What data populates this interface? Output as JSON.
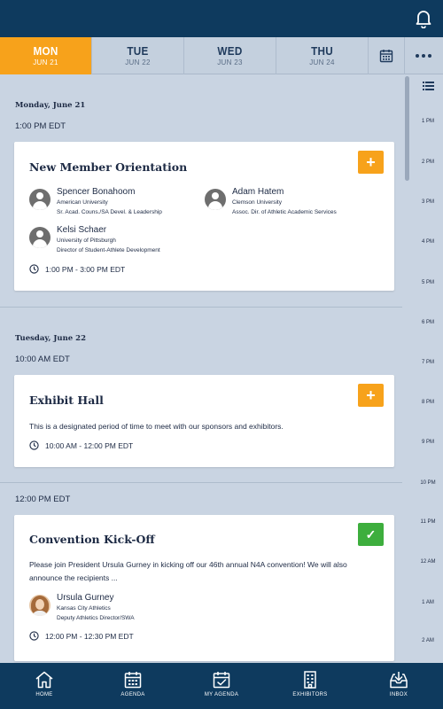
{
  "days": [
    {
      "day": "MON",
      "date": "JUN 21",
      "active": true
    },
    {
      "day": "TUE",
      "date": "JUN 22",
      "active": false
    },
    {
      "day": "WED",
      "date": "JUN 23",
      "active": false
    },
    {
      "day": "THU",
      "date": "JUN 24",
      "active": false
    }
  ],
  "icons": {
    "bell": "bell-icon",
    "calendar": "calendar-icon",
    "more": "more-icon",
    "list": "list-icon",
    "add": "plus-icon",
    "added": "checkmark-icon",
    "clock": "clock-icon"
  },
  "colors": {
    "topbar": "#0e3a5e",
    "accent": "#f7a21b",
    "added": "#3dae3d"
  },
  "sections": {
    "mon": {
      "day_label": "Monday, June 21",
      "time_label": "1:00 PM EDT"
    },
    "tue": {
      "day_label": "Tuesday, June 22",
      "time_label": "10:00 AM EDT"
    },
    "tue2": {
      "time_label": "12:00 PM EDT"
    }
  },
  "events": {
    "orientation": {
      "title": "New Member Orientation",
      "add_label": "+",
      "time": "1:00 PM - 3:00 PM EDT",
      "speakers": [
        {
          "name": "Spencer Bonahoom",
          "org": "American University",
          "role": "Sr. Acad. Couns./SA Devel. & Leadership"
        },
        {
          "name": "Adam Hatem",
          "org": "Clemson University",
          "role": "Assoc. Dir. of Athletic Academic Services"
        },
        {
          "name": "Kelsi Schaer",
          "org": "University of Pittsburgh",
          "role": "Director of Student-Athlete Development"
        }
      ]
    },
    "exhibit": {
      "title": "Exhibit Hall",
      "add_label": "+",
      "description": "This is a designated period of time to meet with our sponsors and exhibitors.",
      "time": "10:00 AM - 12:00 PM EDT"
    },
    "kickoff": {
      "title": "Convention Kick-Off",
      "added_label": "✓",
      "description": "Please join President Ursula Gurney in kicking off our 46th annual N4A convention! We will also announce the recipients ...",
      "time": "12:00 PM - 12:30 PM EDT",
      "speakers": [
        {
          "name": "Ursula Gurney",
          "org": "Kansas City Athletics",
          "role": "Deputy Athletics Director/SWA"
        }
      ]
    }
  },
  "rail_hours": [
    "1 PM",
    "2 PM",
    "3 PM",
    "4 PM",
    "5 PM",
    "6 PM",
    "7 PM",
    "8 PM",
    "9 PM",
    "10 PM",
    "11 PM",
    "12 AM",
    "1 AM",
    "2 AM"
  ],
  "nav": [
    {
      "label": "HOME",
      "icon": "home-icon"
    },
    {
      "label": "AGENDA",
      "icon": "agenda-icon"
    },
    {
      "label": "MY AGENDA",
      "icon": "my-agenda-icon"
    },
    {
      "label": "EXHIBITORS",
      "icon": "exhibitors-icon"
    },
    {
      "label": "INBOX",
      "icon": "inbox-icon"
    }
  ]
}
